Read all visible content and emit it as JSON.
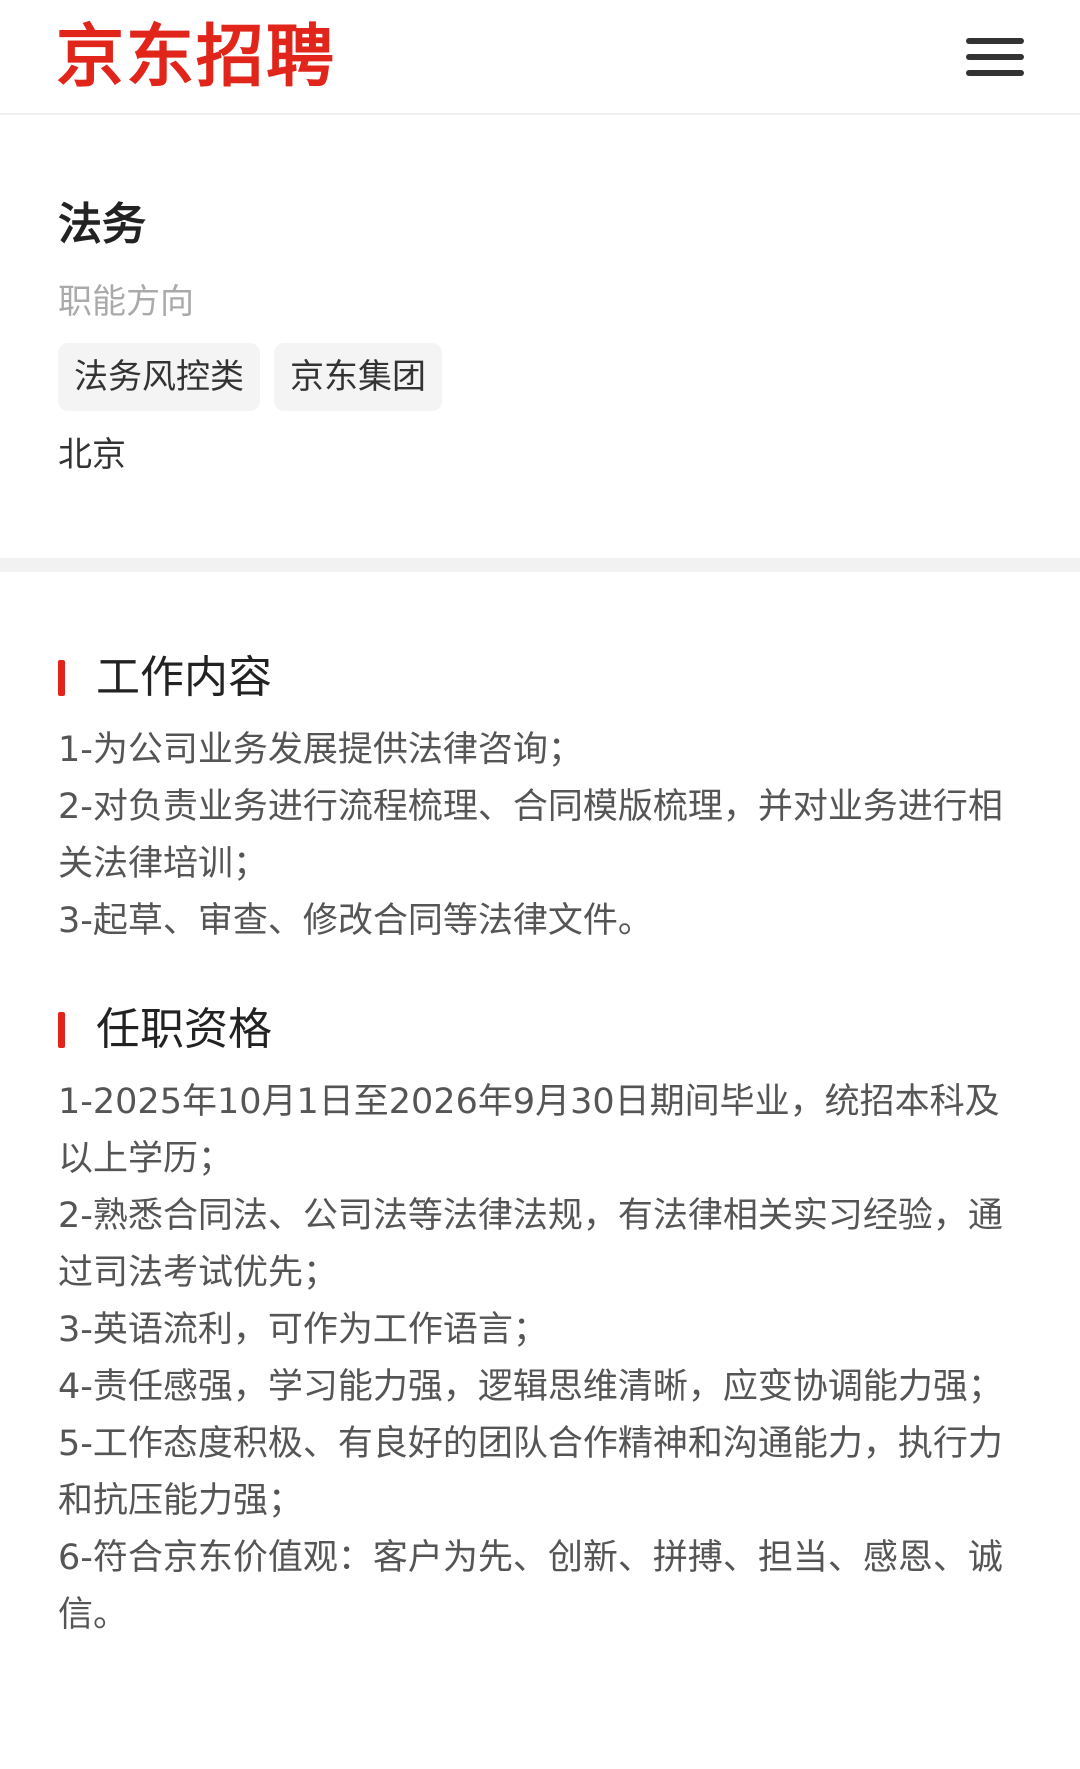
{
  "header": {
    "logo_text": "京东招聘",
    "menu_icon": "hamburger-menu-icon",
    "brand_color": "#e1251b"
  },
  "job": {
    "title": "法务",
    "subtitle": "职能方向",
    "tags": [
      "法务风控类",
      "京东集团"
    ],
    "location": "北京"
  },
  "sections": [
    {
      "title": "工作内容",
      "items": [
        "1-为公司业务发展提供法律咨询；",
        "2-对负责业务进行流程梳理、合同模版梳理，并对业务进行相关法律培训；",
        "3-起草、审查、修改合同等法律文件。"
      ]
    },
    {
      "title": "任职资格",
      "items": [
        "1-2025年10月1日至2026年9月30日期间毕业，统招本科及以上学历；",
        "2-熟悉合同法、公司法等法律法规，有法律相关实习经验，通过司法考试优先；",
        "3-英语流利，可作为工作语言；",
        "4-责任感强，学习能力强，逻辑思维清晰，应变协调能力强；",
        "5-工作态度积极、有良好的团队合作精神和沟通能力，执行力和抗压能力强；",
        "6-符合京东价值观：客户为先、创新、拼搏、担当、感恩、诚信。"
      ]
    }
  ]
}
